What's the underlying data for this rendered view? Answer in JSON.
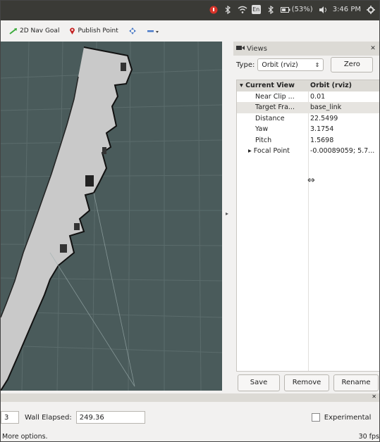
{
  "system_tray": {
    "battery": "(53%)",
    "lang": "En",
    "time": "3:46 PM"
  },
  "toolbar": {
    "nav_goal": "2D Nav Goal",
    "publish_point": "Publish Point"
  },
  "views_panel": {
    "title": "Views",
    "type_label": "Type:",
    "type_value": "Orbit (rviz)",
    "zero_button": "Zero",
    "current_view": {
      "key": "Current View",
      "value": "Orbit (rviz)"
    },
    "properties": [
      {
        "key": "Near Clip ...",
        "value": "0.01"
      },
      {
        "key": "Target Fra...",
        "value": "base_link"
      },
      {
        "key": "Distance",
        "value": "22.5499"
      },
      {
        "key": "Yaw",
        "value": "3.1754"
      },
      {
        "key": "Pitch",
        "value": "1.5698"
      },
      {
        "key": "Focal Point",
        "value": "-0.00089059; 5.7..."
      }
    ],
    "buttons": {
      "save": "Save",
      "remove": "Remove",
      "rename": "Rename"
    }
  },
  "time_panel": {
    "ros_elapsed_partial": "3",
    "wall_elapsed_label": "Wall Elapsed:",
    "wall_elapsed_value": "249.36",
    "experimental_label": "Experimental"
  },
  "status": {
    "hint": "More options.",
    "fps": "30 fps"
  },
  "colors": {
    "viewport_bg": "#4a5b5b",
    "map_free": "#c9c9c9",
    "panel_bg": "#f2f1f0"
  }
}
